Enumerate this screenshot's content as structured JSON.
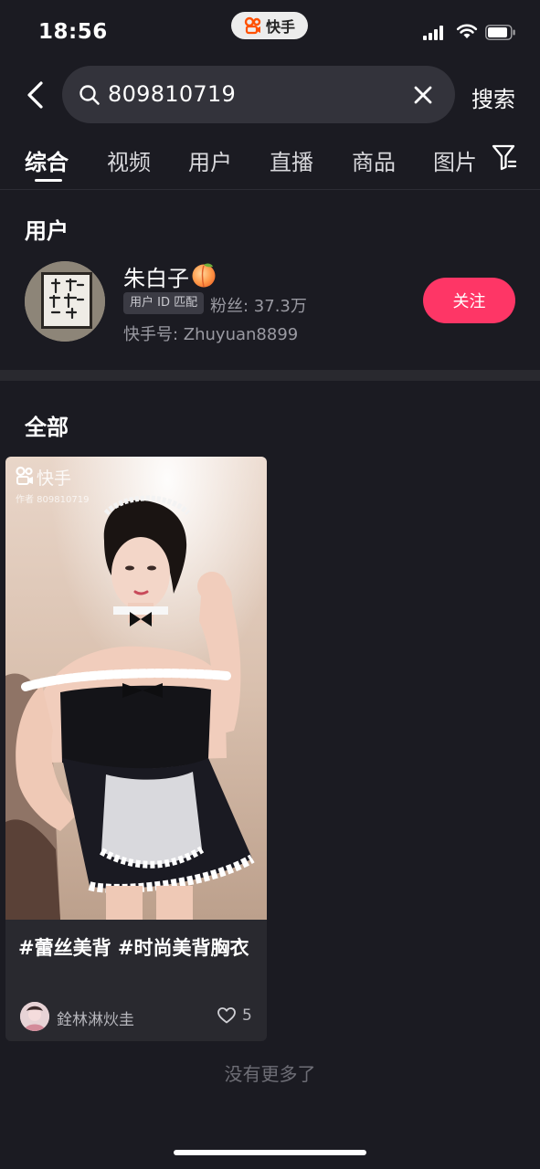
{
  "status_bar": {
    "time": "18:56",
    "app_pill": "快手",
    "icons": [
      "signal-icon",
      "wifi-icon",
      "battery-icon"
    ]
  },
  "search": {
    "query": "809810719",
    "submit_label": "搜索"
  },
  "tabs": [
    {
      "label": "综合",
      "active": true
    },
    {
      "label": "视频",
      "active": false
    },
    {
      "label": "用户",
      "active": false
    },
    {
      "label": "直播",
      "active": false
    },
    {
      "label": "商品",
      "active": false
    },
    {
      "label": "图片",
      "active": false
    }
  ],
  "user_section": {
    "title": "用户",
    "user": {
      "name": "朱白子",
      "badge": "用户 ID 匹配",
      "fans": "粉丝: 37.3万",
      "kuaishou_id": "快手号: Zhuyuan8899",
      "follow_label": "关注"
    }
  },
  "all_section": {
    "title": "全部",
    "cards": [
      {
        "watermark_brand": "快手",
        "watermark_author": "作者 809810719",
        "caption": "#蕾丝美背 #时尚美背胸衣",
        "author": "銓林淋炏圭",
        "likes": "5"
      }
    ]
  },
  "footer": {
    "no_more": "没有更多了"
  },
  "colors": {
    "background": "#1b1b22",
    "accent": "#fe3666",
    "search_box": "#33333b"
  }
}
